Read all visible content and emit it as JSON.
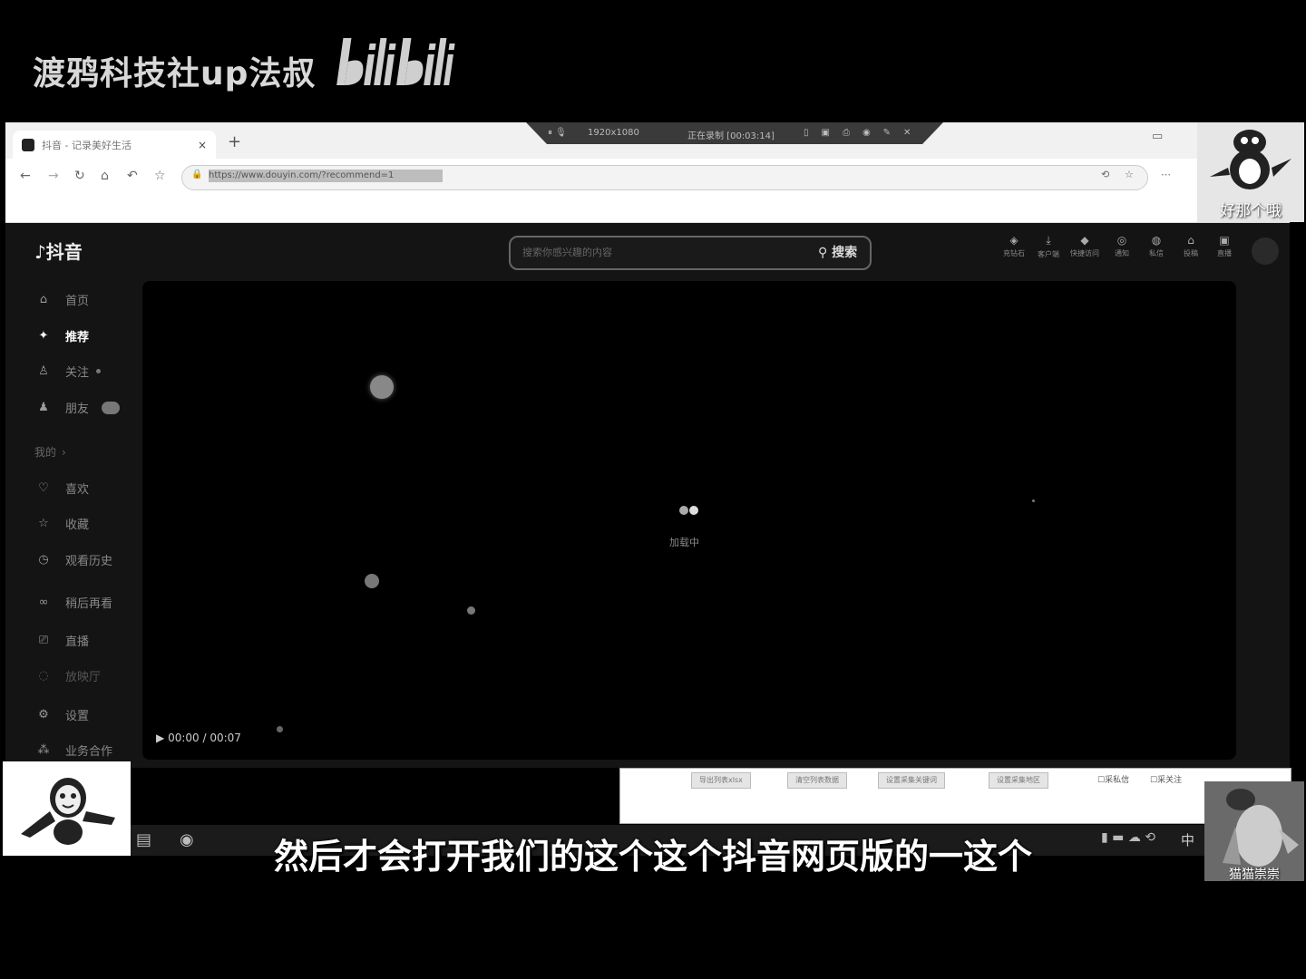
{
  "watermark": {
    "text": "渡鸦科技社up法叔",
    "logo": "bilibili"
  },
  "browser": {
    "tab_title": "抖音 - 记录美好生活",
    "tab_close": "×",
    "new_tab": "+",
    "url": "https://www.douyin.com/?recommend=1",
    "recorder": {
      "resolution": "1920x1080",
      "status": "正在录制 [00:03:14]"
    }
  },
  "douyin": {
    "logo": "抖音",
    "search": {
      "placeholder": "搜索你感兴趣的内容",
      "button": "搜索"
    },
    "top_icons": [
      {
        "icon": "diamond-icon",
        "label": "充钻石"
      },
      {
        "icon": "download-icon",
        "label": "客户端"
      },
      {
        "icon": "wallpaper-icon",
        "label": "快捷访问"
      },
      {
        "icon": "notify-icon",
        "label": "通知"
      },
      {
        "icon": "message-icon",
        "label": "私信"
      },
      {
        "icon": "post-icon",
        "label": "投稿"
      },
      {
        "icon": "live-icon",
        "label": "直播"
      }
    ],
    "sidebar": [
      {
        "icon": "home-icon",
        "label": "首页",
        "active": false
      },
      {
        "icon": "sparkle-icon",
        "label": "推荐",
        "active": true
      },
      {
        "icon": "follow-icon",
        "label": "关注",
        "active": false
      },
      {
        "icon": "friends-icon",
        "label": "朋友",
        "active": false
      },
      {
        "icon": "",
        "label": "我的",
        "active": false
      },
      {
        "icon": "heart-icon",
        "label": "喜欢",
        "active": false
      },
      {
        "icon": "star-icon",
        "label": "收藏",
        "active": false
      },
      {
        "icon": "clock-icon",
        "label": "观看历史",
        "active": false
      },
      {
        "icon": "series-icon",
        "label": "稍后再看",
        "active": false
      },
      {
        "icon": "tv-icon",
        "label": "直播",
        "active": false
      },
      {
        "icon": "trophy-icon",
        "label": "放映厅",
        "active": false
      },
      {
        "icon": "gear-icon",
        "label": "设置",
        "active": false
      },
      {
        "icon": "cooperation-icon",
        "label": "业务合作",
        "active": false
      }
    ],
    "player": {
      "loading": "加载中",
      "time": "00:00 / 00:07"
    }
  },
  "panel": {
    "buttons": [
      "导出列表xlsx",
      "清空列表数据",
      "设置采集关键词",
      "设置采集地区"
    ],
    "checkboxes": [
      "采私信",
      "采关注"
    ]
  },
  "taskbar": {
    "ime": "中"
  },
  "subtitle": "然后才会打开我们的这个这个抖音网页版的一这个",
  "webcams": [
    {
      "name": "好那个哦"
    },
    {
      "name": "猫猫崇崇"
    }
  ]
}
